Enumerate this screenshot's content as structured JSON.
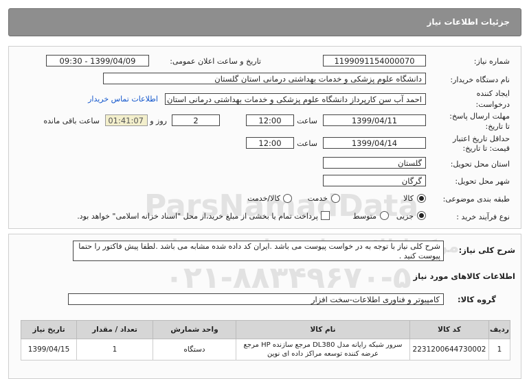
{
  "header": {
    "title": "جزئیات اطلاعات نیاز"
  },
  "form": {
    "need_number_label": "شماره نیاز:",
    "need_number": "1199091154000070",
    "announce_label": "تاریخ و ساعت اعلان عمومی:",
    "announce_value": "1399/04/09 - 09:30",
    "buyer_org_label": "نام دستگاه خریدار:",
    "buyer_org": "دانشگاه علوم پزشکی و خدمات بهداشتی درمانی استان گلستان",
    "creator_label_1": "ایجاد کننده",
    "creator_label_2": "درخواست:",
    "creator": "احمد آب سن کارپرداز دانشگاه علوم پزشکی و خدمات بهداشتی درمانی استان",
    "contact_link": "اطلاعات تماس خریدار",
    "deadline_label_1": "مهلت ارسال پاسخ:",
    "deadline_label_2": "تا تاریخ:",
    "deadline_date": "1399/04/11",
    "time_label": "ساعت",
    "deadline_time": "12:00",
    "days_value": "2",
    "days_label": "روز و",
    "remaining_time": "01:41:07",
    "remaining_label": "ساعت باقی مانده",
    "validity_label_1": "حداقل تاریخ اعتبار",
    "validity_label_2": "قیمت: تا تاریخ:",
    "validity_date": "1399/04/14",
    "validity_time": "12:00",
    "province_label": "استان محل تحویل:",
    "province": "گلستان",
    "city_label": "شهر محل تحویل:",
    "city": "گرگان",
    "category_label": "طبقه بندی موضوعی:",
    "category_options": [
      "کالا",
      "خدمت",
      "کالا/خدمت"
    ],
    "category_selected": "کالا",
    "process_label": "نوع فرآیند خرید :",
    "process_options": [
      "جزیی",
      "متوسط"
    ],
    "process_selected": "جزیی",
    "payment_note": "پرداخت تمام یا بخشی از مبلغ خرید،از محل \"اسناد خزانه اسلامی\" خواهد بود."
  },
  "description": {
    "label": "شرح کلی نیاز:",
    "text": "شرح کلی نیاز با توجه به در خواست پیوست می باشد .ایران کد داده شده مشابه می باشد .لطفا پیش فاکتور را حتما پیوست کنید ."
  },
  "items_section": {
    "title": "اطلاعات کالاهای مورد نیاز",
    "group_label": "گروه کالا:",
    "group_value": "کامپیوتر و فناوری اطلاعات-سخت افزار",
    "columns": [
      "ردیف",
      "کد کالا",
      "نام کالا",
      "واحد شمارش",
      "تعداد / مقدار",
      "تاریخ نیاز"
    ],
    "rows": [
      {
        "row": "1",
        "code": "2231200644730002",
        "name": "سرور شبکه رایانه مدل DL380 مرجع سازنده HP مرجع عرضه کننده توسعه مراکز داده ای نوین",
        "unit": "دستگاه",
        "qty": "1",
        "date": "1399/04/15"
      }
    ]
  },
  "watermark": {
    "line1": "ParsNamadData",
    "line2": "مرکز اطلاع رسانی مناقصه و مزایده",
    "line3": "۰۲۱-۸۸۳۴۹۶۷۰-۵"
  }
}
